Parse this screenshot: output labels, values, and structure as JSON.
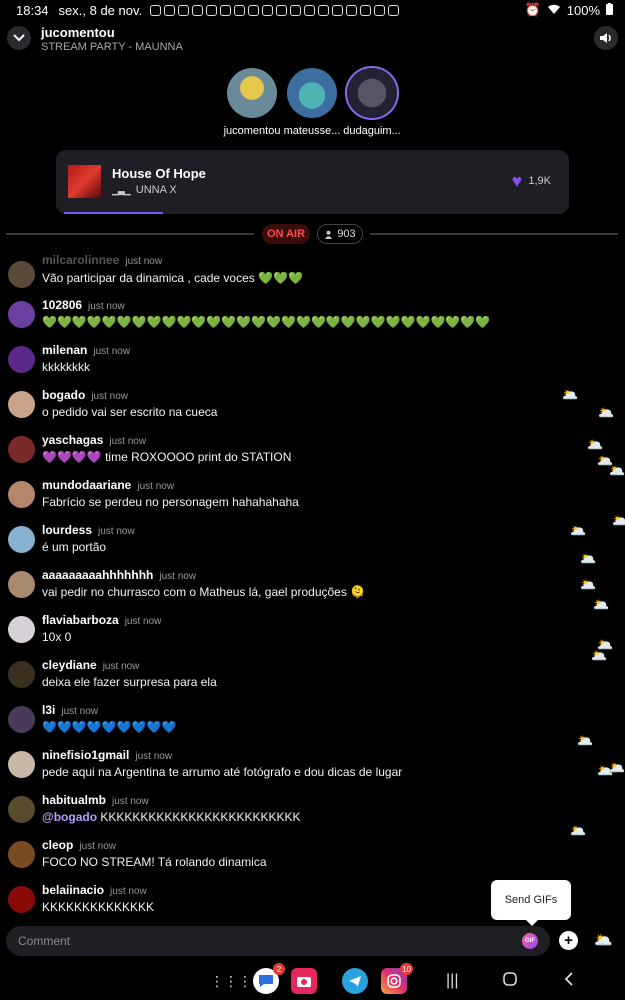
{
  "status_bar": {
    "time": "18:34",
    "date": "sex., 8 de nov.",
    "battery": "100%"
  },
  "header": {
    "host": "jucomentou",
    "party": "STREAM PARTY - MAUNNA"
  },
  "participants": [
    {
      "name": "jucomentou"
    },
    {
      "name": "mateusse..."
    },
    {
      "name": "dudaguim..."
    }
  ],
  "track": {
    "title": "House Of Hope",
    "artist": "UNNA X",
    "likes": "1,9K",
    "progress": 0.2
  },
  "live": {
    "on_air_label": "ON AIR",
    "viewers": "903"
  },
  "messages": [
    {
      "user": "milcarolinnee",
      "time": "just now",
      "text": "Vão participar da dinamica , cade voces 💚💚💚"
    },
    {
      "user": "102806",
      "time": "just now",
      "text": "💚💚💚💚💚💚💚💚💚💚💚💚💚💚💚💚💚💚💚💚💚💚💚💚💚💚💚💚💚💚"
    },
    {
      "user": "milenan",
      "time": "just now",
      "text": "kkkkkkkk"
    },
    {
      "user": "bogado",
      "time": "just now",
      "text": "o pedido vai ser escrito na cueca"
    },
    {
      "user": "yaschagas",
      "time": "just now",
      "text": "💜💜💜💜 time ROXOOOO print do STATION"
    },
    {
      "user": "mundodaariane",
      "time": "just now",
      "text": "Fabrício se perdeu no personagem hahahahaha"
    },
    {
      "user": "lourdess",
      "time": "just now",
      "text": " é um portão"
    },
    {
      "user": "aaaaaaaaahhhhhhh",
      "time": "just now",
      "text": "vai pedir no churrasco com o Matheus lá, gael produções 🫠"
    },
    {
      "user": "flaviabarboza",
      "time": "just now",
      "text": "10x 0"
    },
    {
      "user": "cleydiane",
      "time": "just now",
      "text": "deixa ele fazer surpresa para ela"
    },
    {
      "user": "l3i",
      "time": "just now",
      "text": "💙💙💙💙💙💙💙💙💙"
    },
    {
      "user": "ninefisio1gmail",
      "time": "just now",
      "text": "pede aqui na Argentina te arrumo até fotógrafo e dou dicas de lugar"
    },
    {
      "user": "habitualmb",
      "time": "just now",
      "mention": "@bogado",
      "text": "KKKKKKKKKKKKKKKKKKKKKKKKK"
    },
    {
      "user": "cleop",
      "time": "just now",
      "text": "FOCO NO STREAM! Tá rolando dinamica"
    },
    {
      "user": "belaiinacio",
      "time": "just now",
      "text": "KKKKKKKKKKKKKK"
    }
  ],
  "composer": {
    "placeholder": "Comment",
    "gif_label": "GIF",
    "tooltip": "Send GIFs"
  },
  "navbar": {
    "messages_badge": "2",
    "instagram_badge": "10"
  },
  "colors": {
    "accent": "#7b5cf0",
    "on_air": "#ff4b4b",
    "mention": "#b79cff"
  }
}
